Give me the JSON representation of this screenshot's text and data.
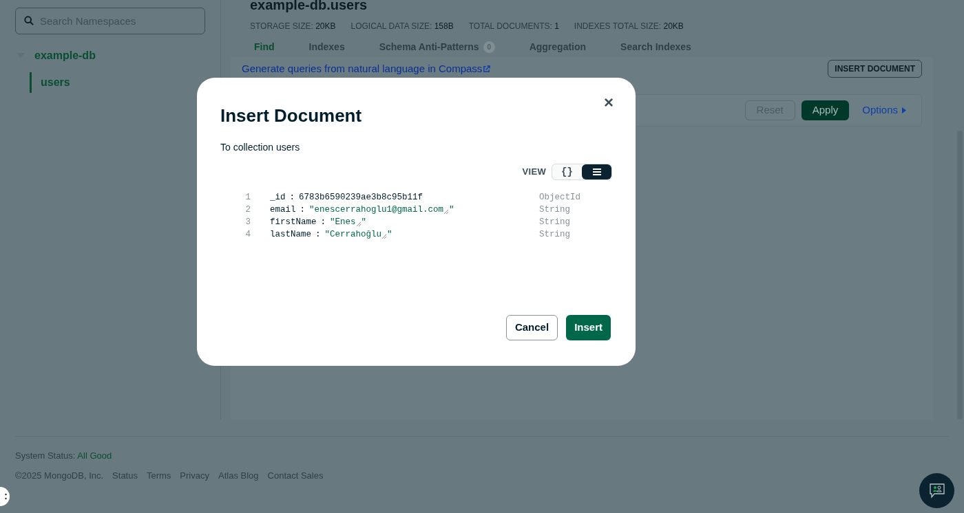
{
  "sidebar": {
    "search": {
      "placeholder": "Search Namespaces"
    },
    "tree": [
      {
        "label": "example-db",
        "expanded": true,
        "children": [
          {
            "label": "users",
            "selected": true
          }
        ]
      }
    ]
  },
  "collection": {
    "title": "example-db.users",
    "stats": [
      {
        "label": "STORAGE SIZE:",
        "value": "20KB"
      },
      {
        "label": "LOGICAL DATA SIZE:",
        "value": "158B"
      },
      {
        "label": "TOTAL DOCUMENTS:",
        "value": "1"
      },
      {
        "label": "INDEXES TOTAL SIZE:",
        "value": "20KB"
      }
    ],
    "tabs": [
      {
        "label": "Find",
        "selected": true
      },
      {
        "label": "Indexes",
        "selected": false
      },
      {
        "label": "Schema Anti-Patterns",
        "selected": false,
        "badge": "0"
      },
      {
        "label": "Aggregation",
        "selected": false
      },
      {
        "label": "Search Indexes",
        "selected": false
      }
    ],
    "nl_link": "Generate queries from natural language in Compass",
    "insert_button": "INSERT DOCUMENT",
    "query_bar": {
      "reset": "Reset",
      "apply": "Apply",
      "options": "Options"
    }
  },
  "footer": {
    "status_label": "System Status:",
    "status_value": "All Good",
    "copyright": "©2025 MongoDB, Inc.",
    "links": [
      "Status",
      "Terms",
      "Privacy",
      "Atlas Blog",
      "Contact Sales"
    ]
  },
  "modal": {
    "title": "Insert Document",
    "close": "×",
    "subtitle": "To collection users",
    "view_label": "VIEW",
    "view_options": [
      {
        "kind": "json",
        "label": "{}",
        "selected": false
      },
      {
        "kind": "list",
        "selected": true
      }
    ],
    "fields": [
      {
        "line": "1",
        "key": "_id",
        "separator": ":",
        "value": "6783b6590239ae3b8c95b11f",
        "kind": "plain",
        "type": "ObjectId"
      },
      {
        "line": "2",
        "key": "email",
        "separator": ":",
        "value": "\"enescerrahoglu1@gmail.com",
        "closing_quote": "\"",
        "kind": "string",
        "type": "String"
      },
      {
        "line": "3",
        "key": "firstName",
        "separator": ":",
        "value": "\"Enes",
        "closing_quote": "\"",
        "kind": "string",
        "type": "String"
      },
      {
        "line": "4",
        "key": "lastName",
        "separator": ":",
        "value": "\"Cerrahoğlu",
        "closing_quote": "\"",
        "kind": "string",
        "type": "String"
      }
    ],
    "buttons": [
      {
        "kind": "secondary",
        "label": "Cancel"
      },
      {
        "kind": "primary",
        "label": "Insert"
      }
    ]
  }
}
